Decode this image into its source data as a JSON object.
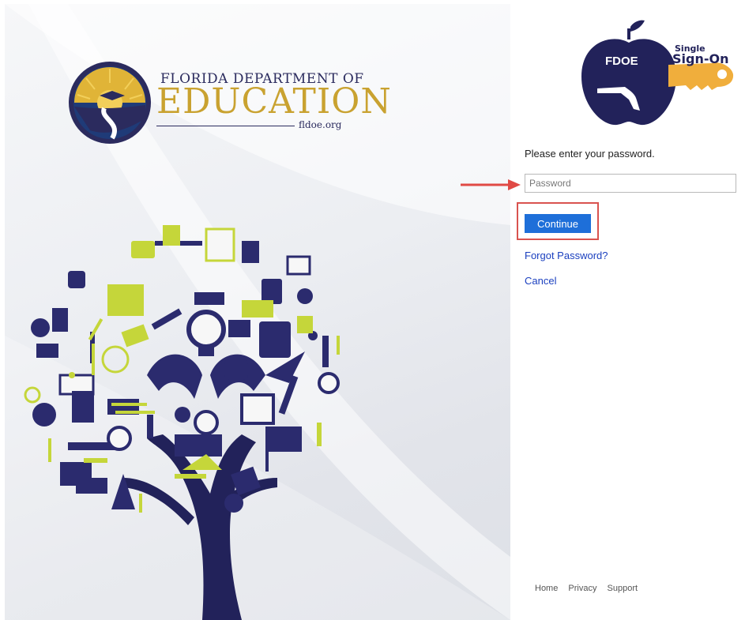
{
  "fdoe": {
    "title": "Florida Department of",
    "title_display": "FLORIDA DEPARTMENT OF",
    "education": "EDUCATION",
    "url": "fldoe.org"
  },
  "sso": {
    "fdoe": "FDOE",
    "single": "Single",
    "signon": "Sign-On"
  },
  "form": {
    "prompt": "Please enter your password.",
    "password_placeholder": "Password",
    "continue_label": "Continue",
    "forgot_label": "Forgot Password?",
    "cancel_label": "Cancel"
  },
  "footer": {
    "links": [
      "Home",
      "Privacy",
      "Support"
    ]
  },
  "colors": {
    "accent": "#1e6fd9",
    "highlight": "#d9534f",
    "navy": "#2b2b5e",
    "gold": "#c9a230",
    "lime": "#c5d63a"
  },
  "icons": [
    "fdoe-seal-icon",
    "apple-icon",
    "key-icon",
    "tree-illustration",
    "red-arrow-icon"
  ]
}
